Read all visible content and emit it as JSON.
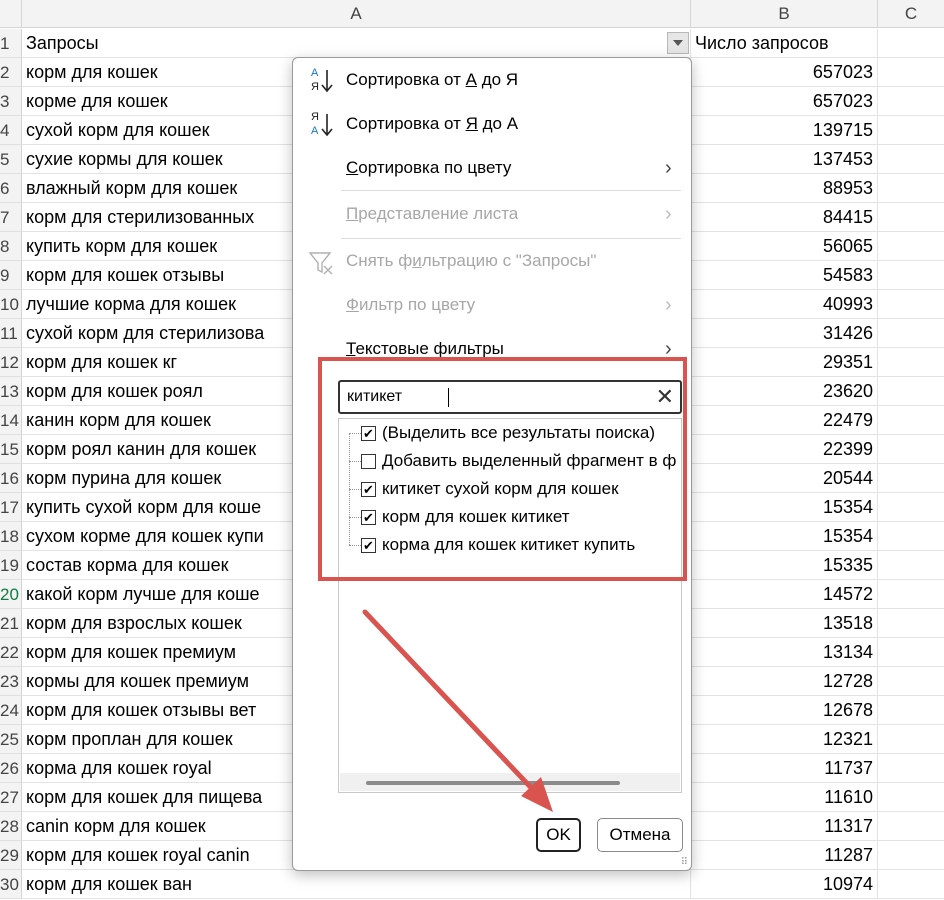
{
  "columns": {
    "a": "A",
    "b": "B",
    "c": "C"
  },
  "rows": [
    {
      "n": "1",
      "a": "Запросы",
      "b": "Число запросов"
    },
    {
      "n": "2",
      "a": "корм для кошек",
      "b": "657023"
    },
    {
      "n": "3",
      "a": "корме для кошек",
      "b": "657023"
    },
    {
      "n": "4",
      "a": "сухой корм для кошек",
      "b": "139715"
    },
    {
      "n": "5",
      "a": "сухие кормы для кошек",
      "b": "137453"
    },
    {
      "n": "6",
      "a": "влажный корм для кошек",
      "b": "88953"
    },
    {
      "n": "7",
      "a": "корм для стерилизованных",
      "b": "84415"
    },
    {
      "n": "8",
      "a": "купить корм для кошек",
      "b": "56065"
    },
    {
      "n": "9",
      "a": "корм для кошек отзывы",
      "b": "54583"
    },
    {
      "n": "10",
      "a": "лучшие корма для кошек",
      "b": "40993"
    },
    {
      "n": "11",
      "a": "сухой корм для стерилизова",
      "b": "31426"
    },
    {
      "n": "12",
      "a": "корм для кошек кг",
      "b": "29351"
    },
    {
      "n": "13",
      "a": "корм для кошек роял",
      "b": "23620"
    },
    {
      "n": "14",
      "a": "канин корм для кошек",
      "b": "22479"
    },
    {
      "n": "15",
      "a": "корм роял канин для кошек",
      "b": "22399"
    },
    {
      "n": "16",
      "a": "корм пурина для кошек",
      "b": "20544"
    },
    {
      "n": "17",
      "a": "купить сухой корм для коше",
      "b": "15354"
    },
    {
      "n": "18",
      "a": "сухом корме для кошек купи",
      "b": "15354"
    },
    {
      "n": "19",
      "a": "состав корма для кошек",
      "b": "15335"
    },
    {
      "n": "20",
      "a": "какой корм лучше для коше",
      "b": "14572"
    },
    {
      "n": "21",
      "a": "корм для взрослых кошек",
      "b": "13518"
    },
    {
      "n": "22",
      "a": "корм для кошек премиум",
      "b": "13134"
    },
    {
      "n": "23",
      "a": "кормы для кошек премиум",
      "b": "12728"
    },
    {
      "n": "24",
      "a": "корм для кошек отзывы вет",
      "b": "12678"
    },
    {
      "n": "25",
      "a": "корм проплан для кошек",
      "b": "12321"
    },
    {
      "n": "26",
      "a": "корма для кошек royal",
      "b": "11737"
    },
    {
      "n": "27",
      "a": "корм для кошек для пищева",
      "b": "11610"
    },
    {
      "n": "28",
      "a": "canin корм для кошек",
      "b": "11317"
    },
    {
      "n": "29",
      "a": "корм для кошек royal canin",
      "b": "11287"
    },
    {
      "n": "30",
      "a": "корм для кошек ван",
      "b": "10974"
    }
  ],
  "menu": {
    "sort_az": {
      "pre": "Сортировка от ",
      "k1": "А",
      "mid": " до Я",
      "icon": "sort-ascending-icon"
    },
    "sort_za": {
      "pre": "Сортировка от ",
      "k1": "Я",
      "mid": " до А",
      "icon": "sort-descending-icon"
    },
    "sort_color": {
      "pre": "",
      "k": "С",
      "post": "ортировка по цвету"
    },
    "sheet_view": {
      "pre": "",
      "k": "П",
      "post": "редставление листа"
    },
    "clear_filter": {
      "pre": "Снять ф",
      "k": "и",
      "post": "льтрацию с \"Запросы\"",
      "icon": "clear-filter-icon"
    },
    "filter_color": {
      "pre": "",
      "k": "Ф",
      "post": "ильтр по цвету"
    },
    "text_filters": {
      "pre": "",
      "k": "Т",
      "post": "екстовые фильтры"
    }
  },
  "search": {
    "value": "китикет"
  },
  "list": [
    {
      "label": "(Выделить все результаты поиска)",
      "checked": true
    },
    {
      "label": "Добавить выделенный фрагмент в ф",
      "checked": false
    },
    {
      "label": "китикет сухой корм для кошек",
      "checked": true
    },
    {
      "label": "корм для кошек китикет",
      "checked": true
    },
    {
      "label": "корма для кошек китикет купить",
      "checked": true
    }
  ],
  "buttons": {
    "ok": "OK",
    "cancel": "Отмена"
  },
  "colors": {
    "annotation": "#d9534f",
    "selected_row_num": "#107c41"
  }
}
